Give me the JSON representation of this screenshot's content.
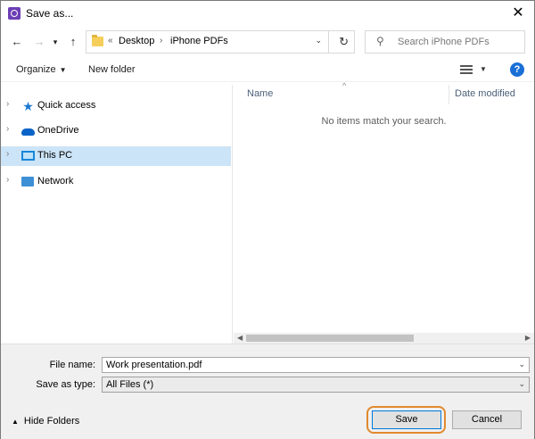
{
  "window": {
    "title": "Save as...",
    "close_glyph": "✕"
  },
  "nav": {
    "back_glyph": "←",
    "forward_glyph": "→",
    "recent_glyph": "▾",
    "up_glyph": "↑"
  },
  "address": {
    "chevrons": "«",
    "crumbs": [
      "Desktop",
      "iPhone PDFs"
    ],
    "separator": "›",
    "dropdown_glyph": "⌄",
    "refresh_glyph": "↻"
  },
  "search": {
    "placeholder": "Search iPhone PDFs",
    "icon_glyph": "⚲"
  },
  "toolbar": {
    "organize_label": "Organize",
    "organize_caret": "▼",
    "new_folder_label": "New folder",
    "view_caret": "▼",
    "help_glyph": "?"
  },
  "tree": {
    "items": [
      {
        "label": "Quick access",
        "icon": "star-icon",
        "selected": false,
        "expander": "›"
      },
      {
        "label": "OneDrive",
        "icon": "cloud-icon",
        "selected": false,
        "expander": "›"
      },
      {
        "label": "This PC",
        "icon": "computer-icon",
        "selected": true,
        "expander": "›"
      },
      {
        "label": "Network",
        "icon": "network-icon",
        "selected": false,
        "expander": "›"
      }
    ]
  },
  "list": {
    "sort_caret": "^",
    "columns": [
      "Name",
      "Date modified"
    ],
    "empty_message": "No items match your search.",
    "scroll_left": "◀",
    "scroll_right": "▶"
  },
  "form": {
    "file_name_label": "File name:",
    "file_name_value": "Work presentation.pdf",
    "save_type_label": "Save as type:",
    "save_type_value": "All Files (*)",
    "caret": "⌄",
    "hide_folders_label": "Hide Folders",
    "hide_caret": "▲",
    "save_label": "Save",
    "cancel_label": "Cancel"
  },
  "colors": {
    "selection": "#cce4f7",
    "accent": "#0078d7",
    "highlight_ring": "#e08a2e",
    "folder": "#f5cf5a"
  }
}
